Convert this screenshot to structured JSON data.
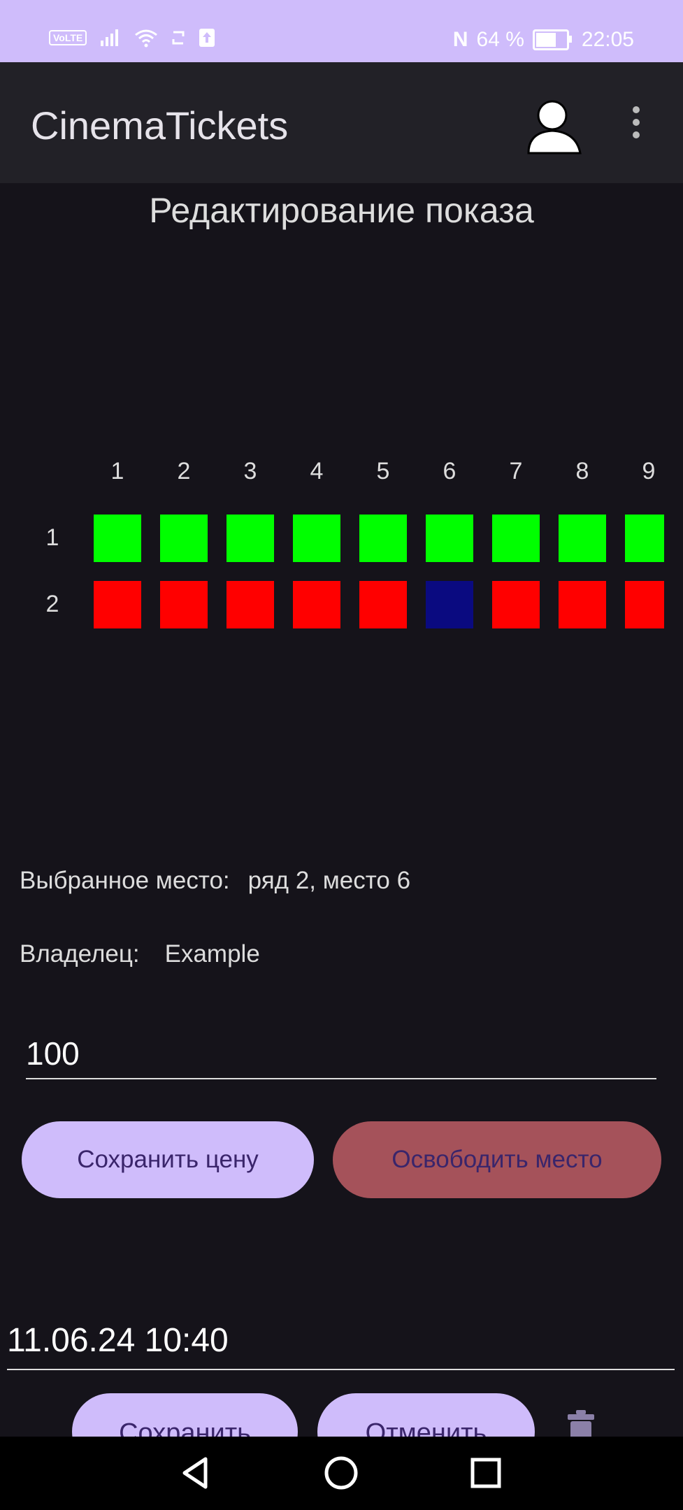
{
  "status_bar": {
    "volte": "VoLTE",
    "nfc": "N",
    "battery_percent": "64 %",
    "time": "22:05",
    "icons": [
      "volte-icon",
      "signal-icon",
      "wifi-icon",
      "sync-icon",
      "upload-icon",
      "nfc-icon",
      "battery-icon"
    ]
  },
  "app_bar": {
    "title": "CinemaTickets",
    "avatar_icon": "user-avatar-icon",
    "menu_icon": "overflow-menu-icon"
  },
  "page": {
    "title": "Редактирование показа"
  },
  "seat_map": {
    "columns": [
      "1",
      "2",
      "3",
      "4",
      "5",
      "6",
      "7",
      "8",
      "9"
    ],
    "rows": [
      {
        "label": "1",
        "seats": [
          "free",
          "free",
          "free",
          "free",
          "free",
          "free",
          "free",
          "free",
          "free"
        ]
      },
      {
        "label": "2",
        "seats": [
          "taken",
          "taken",
          "taken",
          "taken",
          "taken",
          "selected",
          "taken",
          "taken",
          "taken"
        ]
      }
    ],
    "colors": {
      "free": "#00ff00",
      "taken": "#ff0000",
      "selected": "#0a0a80"
    }
  },
  "selection": {
    "selected_label": "Выбранное место:",
    "selected_value": "ряд 2, место 6",
    "owner_label": "Владелец:",
    "owner_value": "Example"
  },
  "price": {
    "value": "100"
  },
  "buttons": {
    "save_price": "Сохранить цену",
    "free_seat": "Освободить место",
    "save": "Сохранить",
    "cancel": "Отменить"
  },
  "datetime": {
    "value": "11.06.24 10:40"
  },
  "colors": {
    "accent": "#cfbcfb",
    "danger": "#a5525a",
    "background": "#15131a",
    "app_bar": "#222127"
  },
  "nav_bar": {
    "icons": [
      "back-icon",
      "home-icon",
      "recents-icon"
    ]
  }
}
